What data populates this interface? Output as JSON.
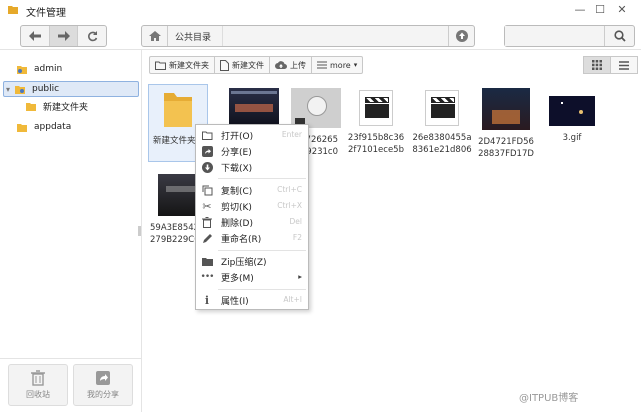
{
  "window": {
    "title": "文件管理",
    "minimize": "—",
    "maximize": "☐",
    "close": "✕"
  },
  "path": {
    "crumb": "公共目录"
  },
  "search": {
    "placeholder": ""
  },
  "tree": [
    {
      "label": "admin"
    },
    {
      "label": "public"
    },
    {
      "label": "新建文件夹"
    },
    {
      "label": "appdata"
    }
  ],
  "sidefoot": {
    "recycle": "回收站",
    "share": "我的分享"
  },
  "actions": {
    "new_folder": "新建文件夹",
    "new_file": "新建文件",
    "upload": "上传",
    "more": "more"
  },
  "files": [
    {
      "name": "新建文件夹"
    },
    {
      "name": ""
    },
    {
      "name": "726265\n9231c0"
    },
    {
      "name": "23f915b8c36\n2f7101ece5b"
    },
    {
      "name": "26e8380455a\n8361e21d806"
    },
    {
      "name": "2D4721FD56\n28837FD17D"
    },
    {
      "name": "3.gif"
    },
    {
      "name": "59A3E8542\n279B229C0"
    }
  ],
  "menu": [
    {
      "label": "打开(O)",
      "shortcut": "Enter"
    },
    {
      "label": "分享(E)",
      "shortcut": ""
    },
    {
      "label": "下载(X)",
      "shortcut": ""
    },
    {
      "label": "复制(C)",
      "shortcut": "Ctrl+C"
    },
    {
      "label": "剪切(K)",
      "shortcut": "Ctrl+X"
    },
    {
      "label": "删除(D)",
      "shortcut": "Del"
    },
    {
      "label": "重命名(R)",
      "shortcut": "F2"
    },
    {
      "label": "Zip压缩(Z)",
      "shortcut": ""
    },
    {
      "label": "更多(M)",
      "shortcut": "▸"
    },
    {
      "label": "属性(I)",
      "shortcut": "Alt+I"
    }
  ],
  "watermark": "@ITPUB博客",
  "colors": {
    "folder": "#f0b93a",
    "selection": "#dfe9f7",
    "accent": "#8fb2e0"
  }
}
